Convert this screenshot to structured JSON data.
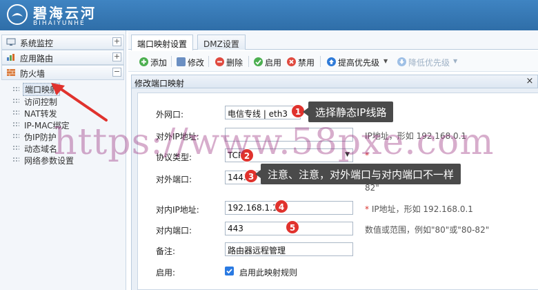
{
  "header": {
    "brand_cn": "碧海云河",
    "brand_en": "BIHAIYUNHE"
  },
  "sidebar": {
    "groups": [
      {
        "label": "系统监控",
        "toggle": "+",
        "icon": "monitor-icon"
      },
      {
        "label": "应用路由",
        "toggle": "+",
        "icon": "routing-icon"
      },
      {
        "label": "防火墙",
        "toggle": "−",
        "icon": "firewall-icon"
      }
    ],
    "items": [
      {
        "label": "端口映射",
        "active": true
      },
      {
        "label": "访问控制"
      },
      {
        "label": "NAT转发"
      },
      {
        "label": "IP-MAC绑定"
      },
      {
        "label": "伪IP防护"
      },
      {
        "label": "动态域名"
      },
      {
        "label": "网络参数设置"
      }
    ]
  },
  "tabs": [
    {
      "label": "端口映射设置",
      "active": true
    },
    {
      "label": "DMZ设置"
    }
  ],
  "toolbar": {
    "add": "添加",
    "edit": "修改",
    "delete": "删除",
    "enable": "启用",
    "disable": "禁用",
    "raise": "提高优先级",
    "lower": "降低优先级"
  },
  "dialog": {
    "title": "修改端口映射",
    "close": "×"
  },
  "form": {
    "wan_label": "外网口:",
    "wan_value": "电信专线 | eth3",
    "ext_ip_label": "对外IP地址:",
    "ext_ip_value": "",
    "ext_ip_hint": "IP地址，形如 192.168.0.1",
    "protocol_label": "协议类型:",
    "protocol_value": "TCP",
    "protocol_hint": "*",
    "ext_port_label": "对外端口:",
    "ext_port_value": "1443",
    "ext_port_hint_tail": "82\"",
    "int_ip_label": "对内IP地址:",
    "int_ip_value": "192.168.1.120",
    "int_ip_hint": "IP地址，形如 192.168.0.1",
    "int_ip_req": "*",
    "int_port_label": "对内端口:",
    "int_port_value": "443",
    "int_port_hint": "数值或范围，例如\"80\"或\"80-82\"",
    "note_label": "备注:",
    "note_value": "路由器远程管理",
    "enable_label": "启用:",
    "enable_checkbox_label": "启用此映射规则",
    "enable_checked": true
  },
  "annotations": {
    "badges": [
      "1",
      "2",
      "3",
      "4",
      "5"
    ],
    "callout1": "选择静态IP线路",
    "callout3": "注意、注意，对外端口与对内端口不一样"
  },
  "watermark": "https://www.58pxe.com",
  "colors": {
    "header": "#3a7dbd",
    "badge": "#e0322d",
    "callout": "#4a4a4a",
    "checkbox": "#2a7ae2",
    "watermark": "#962878"
  }
}
